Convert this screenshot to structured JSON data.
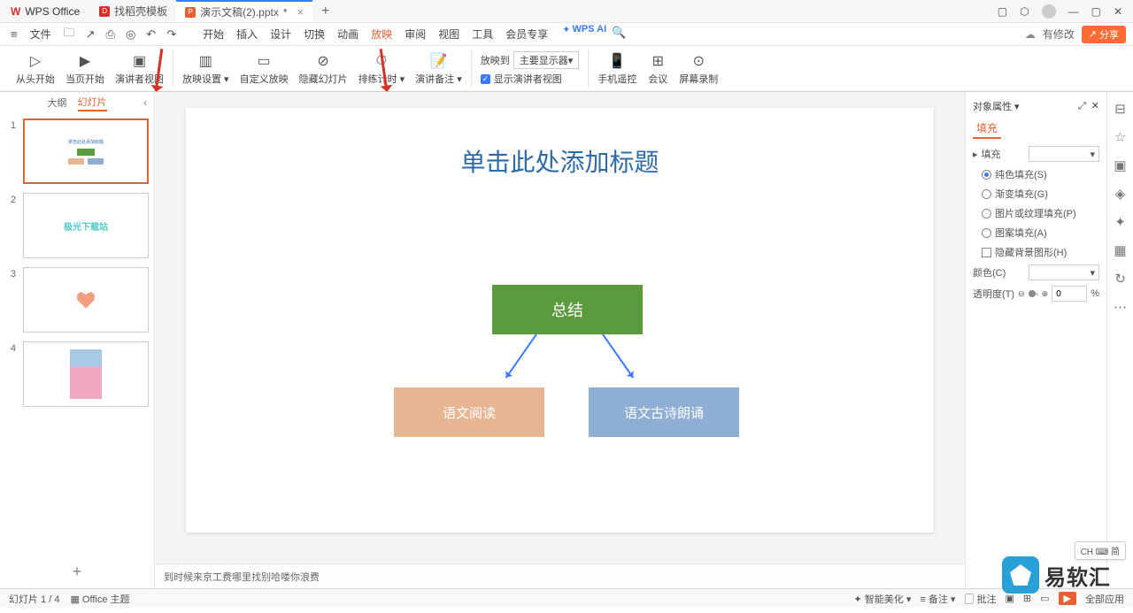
{
  "titlebar": {
    "app": "WPS Office",
    "tabs": [
      {
        "icon": "D",
        "label": "找稻壳模板"
      },
      {
        "icon": "P",
        "label": "演示文稿(2).pptx",
        "active": true,
        "modified": "*"
      }
    ],
    "add": "+"
  },
  "menubar": {
    "file": "文件",
    "tabs": [
      "开始",
      "插入",
      "设计",
      "切换",
      "动画",
      "放映",
      "审阅",
      "视图",
      "工具",
      "会员专享"
    ],
    "active_idx": 5,
    "ai": "WPS AI",
    "modified": "有修改",
    "share": "分享"
  },
  "ribbon": {
    "g1": {
      "a": "从头开始",
      "b": "当页开始",
      "c": "演讲者视图"
    },
    "g2": {
      "a": "放映设置",
      "b": "自定义放映",
      "c": "隐藏幻灯片",
      "d": "排练计时",
      "e": "演讲备注"
    },
    "g3": {
      "a": "放映到",
      "b": "主要显示器",
      "c": "显示演讲者视图"
    },
    "g4": {
      "a": "手机遥控",
      "b": "会议",
      "c": "屏幕录制"
    }
  },
  "pane": {
    "a": "大纲",
    "b": "幻灯片"
  },
  "slides": [
    "1",
    "2",
    "3",
    "4"
  ],
  "slide": {
    "title": "单击此处添加标题",
    "box1": "总结",
    "box2": "语文阅读",
    "box3": "语文古诗朗诵"
  },
  "thumb2_text": "极光下载站",
  "notes": "到时候来京工费哪里找别哈喽你浪费",
  "prop": {
    "title": "对象属性",
    "tab": "填充",
    "section": "填充",
    "r1": "纯色填充(S)",
    "r2": "渐变填充(G)",
    "r3": "图片或纹理填充(P)",
    "r4": "图案填充(A)",
    "c1": "隐藏背景图形(H)",
    "color": "颜色(C)",
    "opacity": "透明度(T)",
    "opacity_val": "0",
    "pct": "%"
  },
  "status": {
    "slide": "幻灯片 1 / 4",
    "theme": "Office 主题",
    "smart": "智能美化",
    "note": "备注",
    "comment": "批注",
    "all": "全部应用"
  },
  "ime": "CH ⌨ 简",
  "wm": "易软汇"
}
